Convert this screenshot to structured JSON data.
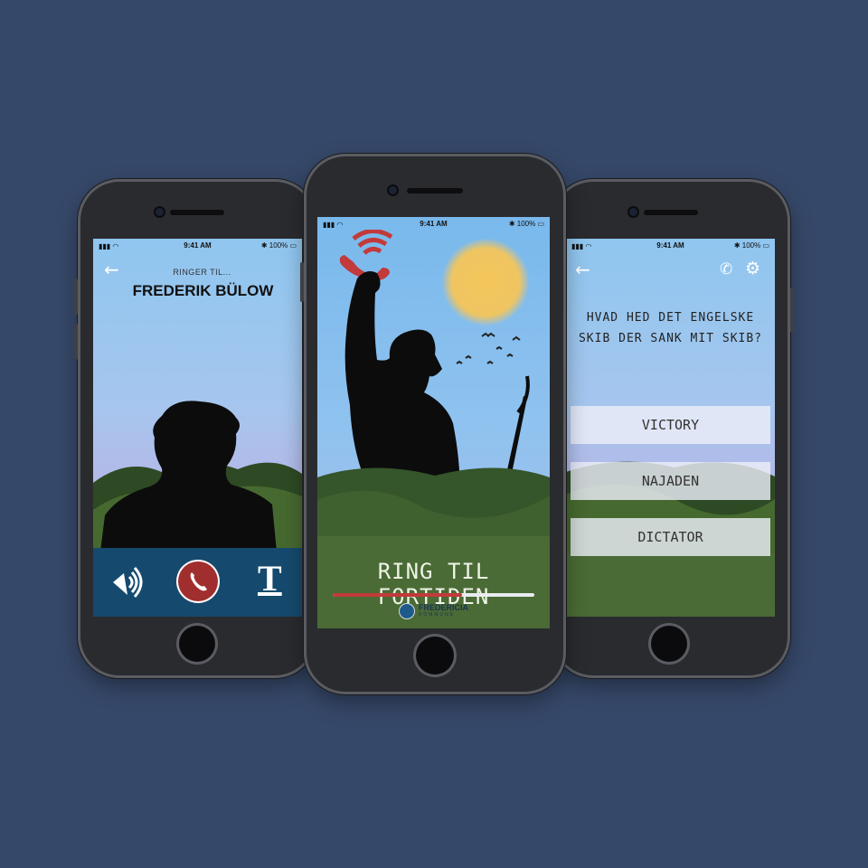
{
  "colors": {
    "background": "#364869",
    "call_bar": "#154a6e",
    "end_call": "#a12e2e",
    "grass": "#4a6b35",
    "accent_red": "#c23a3a"
  },
  "status_bar": {
    "time": "9:41 AM",
    "battery": "100%"
  },
  "left_phone": {
    "calling_label": "RINGER TIL...",
    "caller_name": "FREDERIK BÜLOW",
    "icons": {
      "speaker": "speaker-icon",
      "end_call": "phone-end-icon",
      "text": "text-t-icon"
    }
  },
  "center_phone": {
    "title": "RING TIL FORTIDEN",
    "progress": 0.64,
    "logo_text": "FREDERICIA",
    "logo_subtext": "KOMMUNE"
  },
  "right_phone": {
    "question_line1": "HVAD HED DET  ENGELSKE",
    "question_line2": "SKIB DER SANK MIT SKIB?",
    "answers": [
      "VICTORY",
      "NAJADEN",
      "DICTATOR"
    ]
  }
}
